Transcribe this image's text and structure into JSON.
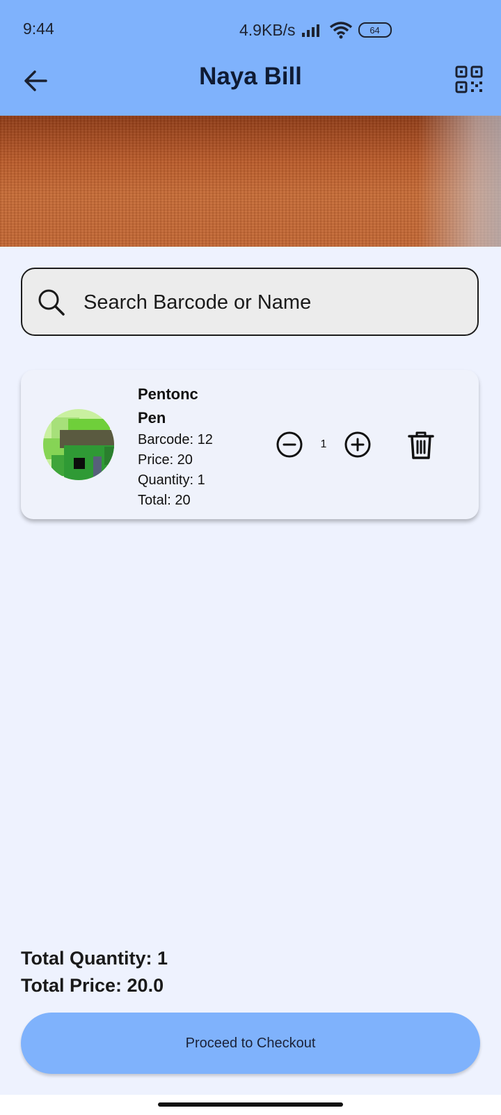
{
  "status_bar": {
    "time": "9:44",
    "network_speed": "4.9KB/s",
    "battery": "64"
  },
  "header": {
    "title": "Naya Bill",
    "bg_color": "#7fb2fc"
  },
  "search": {
    "placeholder": "Search Barcode or Name"
  },
  "cart": {
    "items": [
      {
        "name": "Pentonc Pen",
        "barcode": "Barcode: 12",
        "price": "Price: 20",
        "quantity": "Quantity: 1",
        "total": "Total: 20",
        "stepper_value": "1"
      }
    ]
  },
  "summary": {
    "total_quantity": "Total Quantity: 1",
    "total_price": "Total Price: 20.0"
  },
  "checkout": {
    "label": "Proceed to Checkout"
  }
}
